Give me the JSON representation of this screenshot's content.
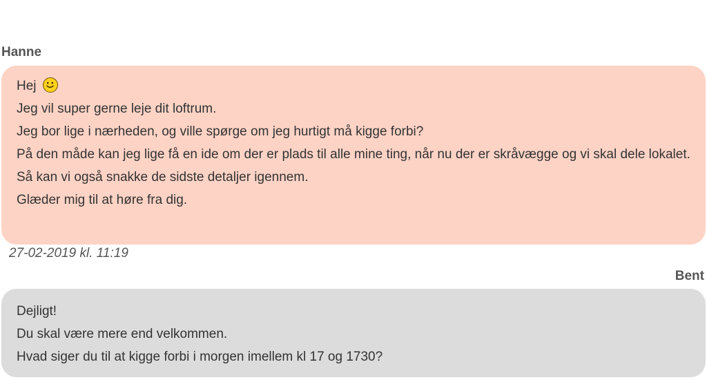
{
  "conversation": {
    "messages": [
      {
        "sender": "Hanne",
        "lines": [
          "Hej",
          "Jeg vil super gerne leje dit loftrum.",
          "Jeg bor lige i nærheden, og ville spørge om jeg hurtigt må kigge forbi?",
          "På den måde kan jeg lige få en ide om der er plads til alle mine ting, når nu der er skråvægge og vi skal dele lokalet.",
          "Så kan vi også snakke de sidste detaljer igennem.",
          "Glæder mig til at høre fra dig."
        ],
        "emoji": "smiley-icon",
        "timestamp": "27-02-2019 kl. 11:19",
        "bubble_color": "#fdd3c5"
      },
      {
        "sender": "Bent",
        "lines": [
          "Dejligt!",
          "Du skal være mere end velkommen.",
          "Hvad siger du til at kigge forbi i morgen imellem kl 17 og 1730?"
        ],
        "bubble_color": "#dcdcdc"
      }
    ]
  }
}
